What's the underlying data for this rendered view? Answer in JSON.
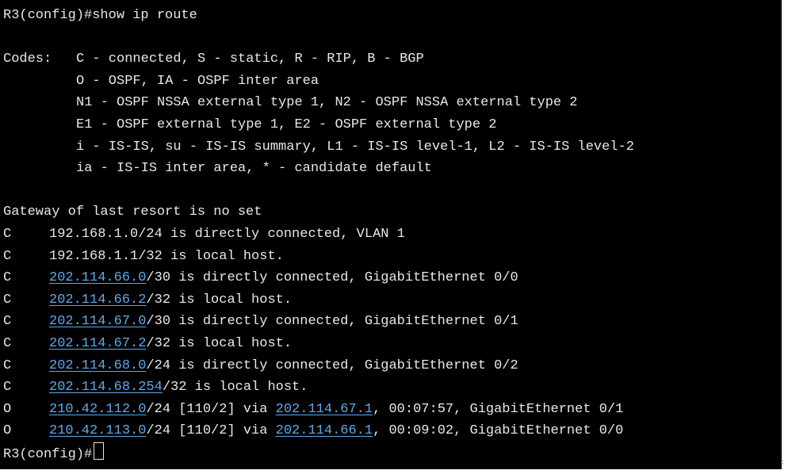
{
  "terminal": {
    "command_prompt": "R3(config)#",
    "command": "show ip route",
    "codes_label": "Codes:",
    "codes_lines": [
      "C - connected, S - static, R - RIP, B - BGP",
      "O - OSPF, IA - OSPF inter area",
      "N1 - OSPF NSSA external type 1, N2 - OSPF NSSA external type 2",
      "E1 - OSPF external type 1, E2 - OSPF external type 2",
      "i - IS-IS, su - IS-IS summary, L1 - IS-IS level-1, L2 - IS-IS level-2",
      "ia - IS-IS inter area, * - candidate default"
    ],
    "gateway_line": "Gateway of last resort is no set",
    "routes": [
      {
        "code": "C",
        "network": "192.168.1.0",
        "network_is_link": false,
        "suffix": "/24 is directly connected, VLAN 1"
      },
      {
        "code": "C",
        "network": "192.168.1.1",
        "network_is_link": false,
        "suffix": "/32 is local host."
      },
      {
        "code": "C",
        "network": "202.114.66.0",
        "network_is_link": true,
        "suffix": "/30 is directly connected, GigabitEthernet 0/0"
      },
      {
        "code": "C",
        "network": "202.114.66.2",
        "network_is_link": true,
        "suffix": "/32 is local host."
      },
      {
        "code": "C",
        "network": "202.114.67.0",
        "network_is_link": true,
        "suffix": "/30 is directly connected, GigabitEthernet 0/1"
      },
      {
        "code": "C",
        "network": "202.114.67.2",
        "network_is_link": true,
        "suffix": "/32 is local host."
      },
      {
        "code": "C",
        "network": "202.114.68.0",
        "network_is_link": true,
        "suffix": "/24 is directly connected, GigabitEthernet 0/2"
      },
      {
        "code": "C",
        "network": "202.114.68.254",
        "network_is_link": true,
        "suffix": "/32 is local host."
      },
      {
        "code": "O",
        "network": "210.42.112.0",
        "network_is_link": true,
        "mid": "/24 [110/2] via ",
        "via": "202.114.67.1",
        "suffix": ", 00:07:57, GigabitEthernet 0/1"
      },
      {
        "code": "O",
        "network": "210.42.113.0",
        "network_is_link": true,
        "mid": "/24 [110/2] via ",
        "via": "202.114.66.1",
        "suffix": ", 00:09:02, GigabitEthernet 0/0"
      }
    ],
    "final_prompt": "R3(config)#"
  },
  "scroll_indicator": "‹",
  "colors": {
    "background": "#000000",
    "text": "#e8e8e8",
    "link": "#5fa8e8"
  }
}
